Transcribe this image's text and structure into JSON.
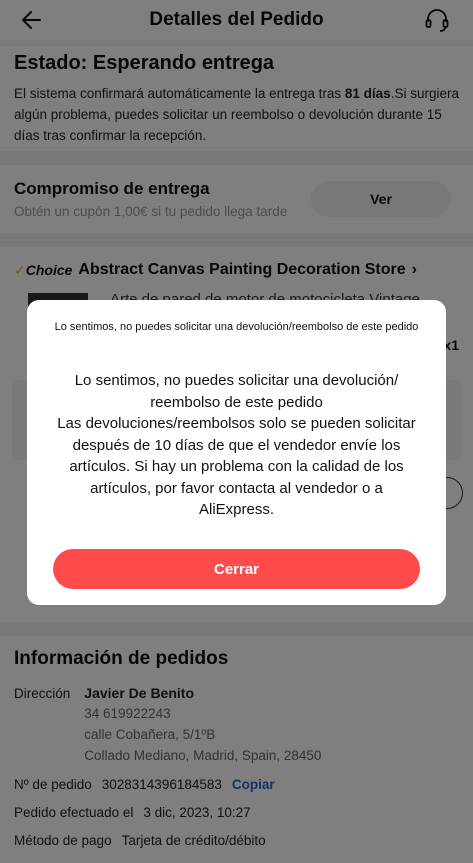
{
  "header": {
    "title": "Detalles del Pedido",
    "back_icon": "arrow-left-icon",
    "support_icon": "headset-icon"
  },
  "status": {
    "title": "Estado: Esperando entrega",
    "text_pre": "El sistema confirmará automáticamente la entrega tras ",
    "text_bold": "81 días",
    "text_post": ".Si surgiera algún problema, puedes solicitar un reembolso o devolución durante 15 días tras confirmar la recepción."
  },
  "commitment": {
    "title": "Compromiso de entrega",
    "subtitle": "Obtén un cupón 1,00€ si tu pedido llega tarde",
    "button": "Ver"
  },
  "store": {
    "choice_label": "Choice",
    "name": "Abstract Canvas Painting Decoration Store",
    "product_title": "Arte de pared de motor de motocicleta Vintage...",
    "quantity": "x1"
  },
  "order_info": {
    "title": "Información de pedidos",
    "address_label": "Dirección",
    "address_name": "Javier De Benito",
    "address_lines": [
      "34 619922243",
      "calle Cobañera, 5/1ºB",
      "Collado Mediano, Madrid, Spain, 28450"
    ],
    "order_no_label": "Nº de pedido",
    "order_no": "3028314396184583",
    "copy_label": "Copiar",
    "placed_label": "Pedido efectuado el",
    "placed_value": "3 dic, 2023, 10:27",
    "payment_label": "Método de pago",
    "payment_value": "Tarjeta de crédito/débito"
  },
  "modal": {
    "header": "Lo sentimos, no puedes solicitar una devolución/reembolso de este pedido",
    "body_line1": "Lo sentimos, no puedes solicitar una devolución/ reembolso de este pedido",
    "body_line2": "Las devoluciones/reembolsos solo se pueden solicitar después de 10 días de que el vendedor envíe los artículos. Si hay un problema con la calidad de los artículos, por favor contacta al vendedor o a AliExpress.",
    "close_button": "Cerrar"
  },
  "colors": {
    "accent_red": "#ff4b4b",
    "link_blue": "#2a62c9",
    "choice_yellow": "#e5b800"
  }
}
